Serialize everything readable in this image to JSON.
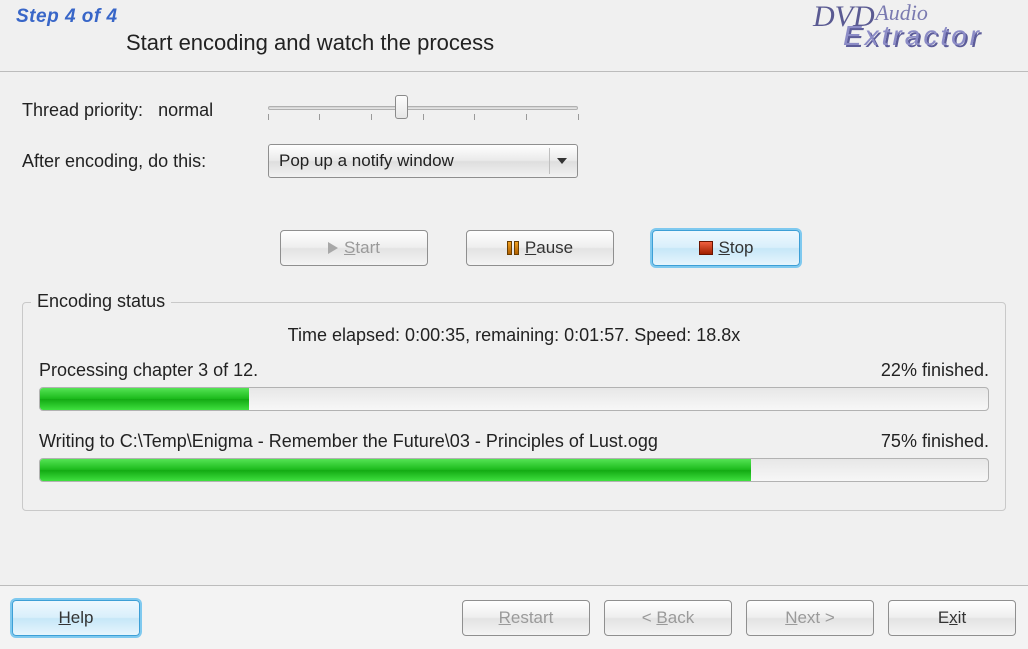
{
  "header": {
    "step_label": "Step 4 of 4",
    "title": "Start encoding and watch the process",
    "logo": {
      "dvd": "DVD",
      "audio": "Audio",
      "extractor": "Extractor"
    }
  },
  "thread_priority": {
    "label": "Thread priority:",
    "value_text": "normal",
    "slider_value": 3,
    "slider_max": 7
  },
  "after_encoding": {
    "label": "After encoding, do this:",
    "selected": "Pop up a notify window"
  },
  "controls": {
    "start": "Start",
    "pause": "Pause",
    "stop": "Stop"
  },
  "status": {
    "group_title": "Encoding status",
    "time_line": "Time elapsed: 0:00:35, remaining: 0:01:57. Speed: 18.8x",
    "item1_left": "Processing chapter 3 of 12.",
    "item1_right": "22% finished.",
    "item1_pct": 22,
    "item2_left": "Writing to C:\\Temp\\Enigma - Remember the Future\\03 - Principles of Lust.ogg",
    "item2_right": "75% finished.",
    "item2_pct": 75
  },
  "footer": {
    "help": "Help",
    "restart": "Restart",
    "back": "< Back",
    "next": "Next >",
    "exit": "Exit"
  }
}
